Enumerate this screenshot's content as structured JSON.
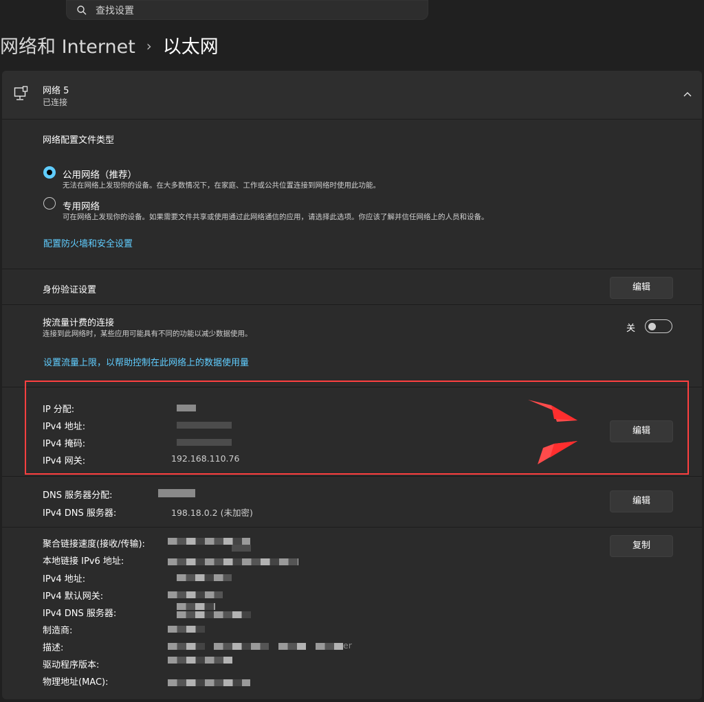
{
  "search": {
    "placeholder": "查找设置"
  },
  "header": {
    "crumb": "网络和 Internet",
    "separator": "›",
    "current": "以太网"
  },
  "network": {
    "name": "网络 5",
    "status": "已连接"
  },
  "profile": {
    "title": "网络配置文件类型",
    "public_label": "公用网络（推荐）",
    "public_desc": "无法在网络上发现你的设备。在大多数情况下，在家庭、工作或公共位置连接到网络时使用此功能。",
    "private_label": "专用网络",
    "private_desc": "可在网络上发现你的设备。如果需要文件共享或使用通过此网络通信的应用，请选择此选项。你应该了解并信任网络上的人员和设备。",
    "selected": "public",
    "firewall_link": "配置防火墙和安全设置"
  },
  "auth": {
    "label": "身份验证设置",
    "button": "编辑"
  },
  "metered": {
    "label": "按流量计费的连接",
    "desc": "连接到此网络时，某些应用可能具有不同的功能以减少数据使用。",
    "state_label": "关",
    "enabled": false,
    "limit_link": "设置流量上限，以帮助控制在此网络上的数据使用量"
  },
  "ip": {
    "assign_label": "IP 分配:",
    "ipv4_label": "IPv4 地址:",
    "mask_label": "IPv4 掩码:",
    "gateway_label": "IPv4 网关:",
    "gateway_value": "192.168.110.76",
    "button": "编辑"
  },
  "dns": {
    "assign_label": "DNS 服务器分配:",
    "server_label": "IPv4 DNS 服务器:",
    "server_value": "198.18.0.2 (未加密)",
    "button": "编辑"
  },
  "props": {
    "speed_label": "聚合链接速度(接收/传输):",
    "ipv6_label": "本地链接 IPv6 地址:",
    "ipv4_label": "IPv4 地址:",
    "gateway_label": "IPv4 默认网关:",
    "dns_label": "IPv4 DNS 服务器:",
    "vendor_label": "制造商:",
    "desc_label": "描述:",
    "desc_suffix": "er",
    "driver_label": "驱动程序版本:",
    "mac_label": "物理地址(MAC):",
    "copy_button": "复制"
  },
  "colors": {
    "accent": "#60cdff",
    "highlight": "#ff4040",
    "background": "#202020",
    "card": "#2b2b2b"
  },
  "icons": [
    "search-icon",
    "ethernet-icon",
    "chevron-up-icon",
    "arrow-icon"
  ]
}
